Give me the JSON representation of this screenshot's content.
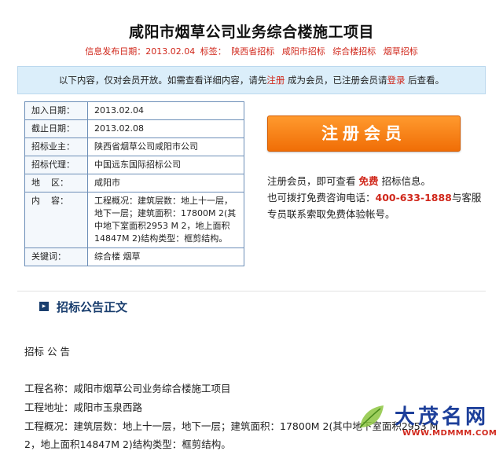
{
  "title": "咸阳市烟草公司业务综合楼施工项目",
  "meta": {
    "date_label": "信息发布日期：2013.02.04",
    "tags_label": "标签：",
    "tags": [
      "陕西省招标",
      "咸阳市招标",
      "综合楼招标",
      "烟草招标"
    ]
  },
  "notice": {
    "text_before": "以下内容，仅对会员开放。如需查看详细内容，请先",
    "register_link": "注册",
    "text_middle": "成为会员，已注册会员请",
    "login_link": "登录",
    "text_after": "后查看。"
  },
  "info_table": [
    {
      "key": "加入日期：",
      "value": "2013.02.04"
    },
    {
      "key": "截止日期：",
      "value": "2013.02.08"
    },
    {
      "key": "招标业主：",
      "value": "陕西省烟草公司咸阳市公司"
    },
    {
      "key": "招标代理：",
      "value": "中国远东国际招标公司"
    },
    {
      "key": "地    区：",
      "value": "咸阳市"
    },
    {
      "key": "内    容：",
      "value": "工程概况：建筑层数：地上十一层，地下一层；建筑面积：17800M 2(其中地下室面积2953 M 2，地上面积14847M 2)结构类型：框剪结构。"
    },
    {
      "key": "关键词：",
      "value": "综合楼 烟草"
    }
  ],
  "register": {
    "button_label": "注册会员",
    "line1_before": "注册会员，即可查看",
    "line1_free": "免费",
    "line1_after": "招标信息。",
    "line2_before": "也可拨打免费咨询电话：",
    "phone": "400-633-1888",
    "line2_after": "与客服专员联系索取免费体验帐号。"
  },
  "section": {
    "icon": "arrow-box-icon",
    "title": "招标公告正文"
  },
  "body": {
    "heading": "招标 公 告",
    "line1": "工程名称：咸阳市烟草公司业务综合楼施工项目",
    "line2": "工程地址：咸阳市玉泉西路",
    "line3": "工程概况：建筑层数：地上十一层，地下一层；建筑面积：17800M 2(其中地下室面积2953 M",
    "line4": "2，地上面积14847M 2)结构类型：框剪结构。"
  },
  "watermark": {
    "name": "大茂名网",
    "url": "WWW.MDMMM.COM"
  }
}
